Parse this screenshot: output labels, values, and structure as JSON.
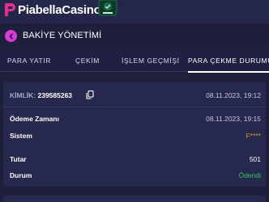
{
  "app": {
    "logo_brand": "Piabella",
    "logo_suffix": "Casino"
  },
  "header": {
    "title": "BAKİYE YÖNETİMİ"
  },
  "tabs": [
    {
      "label": "PARA YATIR"
    },
    {
      "label": "ÇEKİM"
    },
    {
      "label": "İŞLEM GEÇMİŞİ"
    },
    {
      "label": "PARA ÇEKME DURUMU"
    }
  ],
  "transaction": {
    "id_label": "KİMLİK:",
    "id_value": "239585263",
    "created_at": "08.11.2023, 19:12",
    "payment_time_label": "Ödeme Zamanı",
    "payment_time_value": "08.11.2023, 19:15",
    "system_label": "Sistem",
    "system_value": "F****",
    "amount_label": "Tutar",
    "amount_value": "501",
    "status_label": "Durum",
    "status_value": "Ödendi"
  },
  "colors": {
    "background": "#1e1f3b",
    "accent": "#d63bd6",
    "pending": "#d9a03a",
    "success": "#34c759"
  }
}
